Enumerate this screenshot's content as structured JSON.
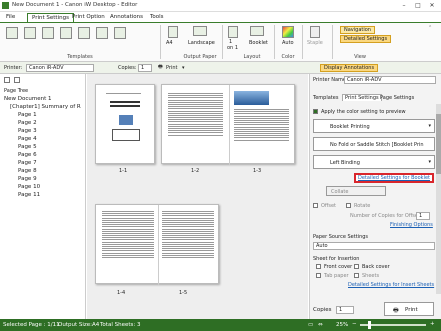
{
  "window": {
    "title": "New Document 1 - Canon iW Desktop - Editor"
  },
  "menu_tabs": [
    "File",
    "Print Settings",
    "Print Option",
    "Annotations",
    "Tools"
  ],
  "ribbon": {
    "templates_label": "Templates",
    "output_paper_label": "Output Paper",
    "layout_label": "Layout",
    "color_label": "Color",
    "view_label": "View",
    "paper_size": "A4",
    "orientation": "Landscape",
    "pages_per_sheet": "1",
    "pages_per_sheet_unit": "on 1",
    "finishing": "Booklet",
    "color_mode": "Auto",
    "staple": "Staple",
    "navigation": "Navigation",
    "detailed_settings": "Detailed Settings"
  },
  "toolbar": {
    "printer_label": "Printer:",
    "printer_value": "Canon iR-ADV",
    "copies_label": "Copies:",
    "copies_value": "1",
    "print_label": "Print",
    "display_annotations": "Display Annotations"
  },
  "left_panel": {
    "tree_title": "Page Tree",
    "root": "New Document 1",
    "chapter": "[Chapter1] Summary of R",
    "pages": [
      "Page 1",
      "Page 2",
      "Page 3",
      "Page 4",
      "Page 5",
      "Page 6",
      "Page 7",
      "Page 8",
      "Page 9",
      "Page 10",
      "Page 11"
    ]
  },
  "center": {
    "page_labels": [
      "1-1",
      "1-2",
      "1-3",
      "1-4",
      "1-5"
    ]
  },
  "right_panel": {
    "printer_name_label": "Printer Name",
    "printer_name_value": "Canon iR-ADV",
    "tabs": [
      "Templates",
      "Print Settings",
      "Page Settings"
    ],
    "apply_color_label": "Apply the color setting to preview",
    "booklet_printing": "Booklet Printing",
    "no_fold": "No Fold or Saddle Stitch [Booklet Prin",
    "left_binding": "Left Binding",
    "booklet_link": "Detailed Settings for Booklet",
    "collate": "Collate",
    "offset": "Offset",
    "rotate": "Rotate",
    "copies_offset_label": "Number of Copies for Offset",
    "copies_offset_value": "1",
    "finishing_options": "Finishing Options",
    "paper_source_label": "Paper Source Settings",
    "paper_source_value": "Auto",
    "sheet_insertion_label": "Sheet for Insertion",
    "front_cover": "Front cover",
    "back_cover": "Back cover",
    "tab_paper": "Tab paper",
    "sheets": "Sheets",
    "insert_sheets_link": "Detailed Settings for Insert Sheets",
    "copies_label": "Copies",
    "copies_value": "1",
    "print_button": "Print"
  },
  "status": {
    "selected_page": "Selected Page : 1/11",
    "output_size": "Output Size:A4",
    "total_sheets": "Total Sheets: 3",
    "zoom": "25%"
  },
  "colors": {
    "accent": "#2e6e24",
    "highlight": "#d9262c",
    "link": "#1a5fb4"
  }
}
